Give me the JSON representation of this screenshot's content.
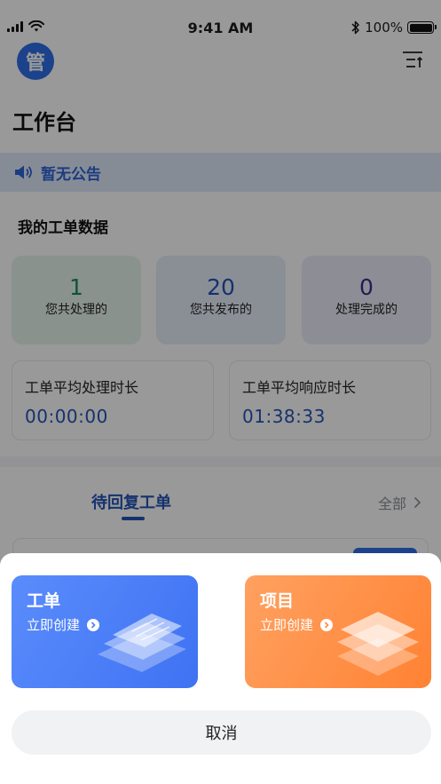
{
  "status_bar": {
    "time": "9:41 AM",
    "battery": "100%"
  },
  "header": {
    "avatar_text": "管",
    "title": "工作台",
    "menu_icon": "sort-menu-icon"
  },
  "notice": {
    "icon": "speaker-icon",
    "text": "暂无公告"
  },
  "ticket_data": {
    "title": "我的工单数据",
    "stats": [
      {
        "value": "1",
        "label": "您共处理的",
        "color": "#1a8a5a"
      },
      {
        "value": "20",
        "label": "您共发布的",
        "color": "#2454b8"
      },
      {
        "value": "0",
        "label": "处理完成的",
        "color": "#3a2e8c"
      }
    ],
    "times": [
      {
        "label": "工单平均处理时长",
        "value": "00:00:00"
      },
      {
        "label": "工单平均响应时长",
        "value": "01:38:33"
      }
    ]
  },
  "tickets": {
    "active_tab": "待回复工单",
    "all_link": "全部"
  },
  "sheet": {
    "cards": [
      {
        "title": "工单",
        "subtitle": "立即创建",
        "color": "#4a7ef6"
      },
      {
        "title": "项目",
        "subtitle": "立即创建",
        "color": "#ff8a3d"
      }
    ],
    "cancel": "取消"
  }
}
